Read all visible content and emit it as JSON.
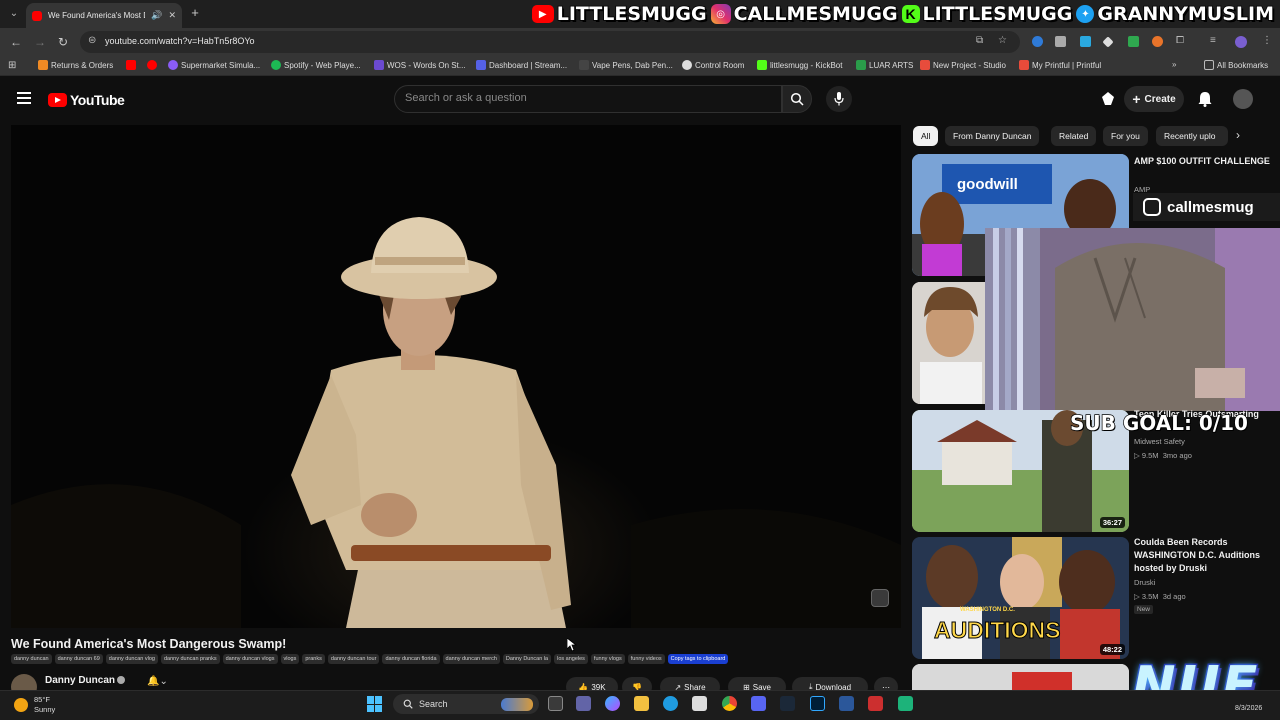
{
  "browser": {
    "tab_title": "We Found America's Most D",
    "url": "youtube.com/watch?v=HabTn5r8OYo",
    "bookmarks": [
      "Returns & Orders",
      "Supermarket Simula...",
      "Spotify - Web Playe...",
      "WOS - Words On St...",
      "Dashboard | Stream...",
      "Vape Pens, Dab Pen...",
      "Control Room",
      "littlesmugg - KickBot",
      "LUAR ARTS",
      "New Project - Studio",
      "My Printful | Printful"
    ],
    "all_bookmarks": "All Bookmarks"
  },
  "stream_overlay": {
    "youtube": "LITTLESMUGG",
    "instagram": "CALLMESMUGG",
    "kick": "LITTLESMUGG",
    "twitter": "GRANNYMUSLIM",
    "webcam_tag": "callmesmug",
    "sub_goal": "SUB GOAL: 0/10",
    "brand": "NUE"
  },
  "youtube": {
    "logo": "YouTube",
    "search_placeholder": "Search or ask a question",
    "create_label": "Create"
  },
  "video": {
    "title": "We Found America's Most Dangerous Swamp!",
    "tags": [
      "danny duncan",
      "danny duncan 69",
      "danny duncan vlog",
      "danny duncan pranks",
      "danny duncan vlogs",
      "vlogs",
      "pranks",
      "danny duncan tour",
      "danny duncan florida",
      "danny duncan merch",
      "Danny Duncan la",
      "los angeles",
      "funny vlogs",
      "funny videos"
    ],
    "copy_tags": "Copy tags to clipboard",
    "channel": "Danny Duncan",
    "likes": "39K",
    "share": "Share",
    "save": "Save",
    "download": "Download"
  },
  "chips": [
    "All",
    "From Danny Duncan",
    "Related",
    "For you",
    "Recently uplo"
  ],
  "related": [
    {
      "title": "AMP $100 OUTFIT CHALLENGE",
      "channel": "AMP",
      "views": "",
      "age": "",
      "duration": "",
      "badge": ""
    },
    {
      "title": "Teen Killer Tries Outsmarting",
      "channel": "Midwest Safety",
      "views": "9.5M",
      "age": "3mo ago",
      "duration": "36:27",
      "badge": ""
    },
    {
      "title": "Coulda Been Records WASHINGTON D.C. Auditions hosted by Druski",
      "channel": "Druski",
      "views": "3.5M",
      "age": "3d ago",
      "duration": "48:22",
      "badge": "New"
    }
  ],
  "thumb_texts": {
    "goodwill": "goodwill",
    "auditions": "AUDITIONS",
    "auditions_sub": "WASHINGTON D.C."
  },
  "taskbar": {
    "temp": "85°F",
    "condition": "Sunny",
    "search": "Search",
    "date": "8/3/2026"
  }
}
